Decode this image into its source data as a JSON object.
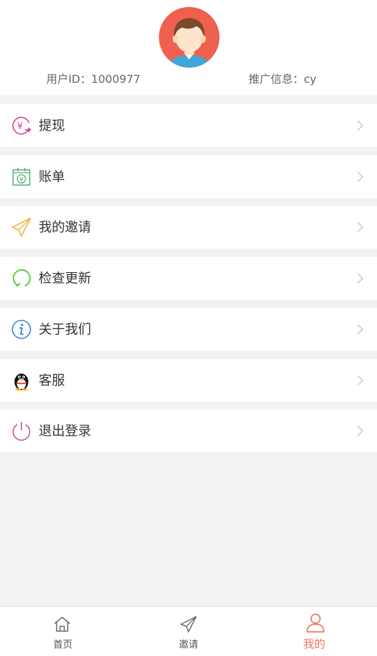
{
  "profile": {
    "user_id": "用户ID：1000977",
    "promo_info": "推广信息：cy"
  },
  "menu": {
    "items": [
      {
        "label": "提现",
        "icon": "yuan-withdraw-icon"
      },
      {
        "label": "账单",
        "icon": "bill-calendar-icon"
      },
      {
        "label": "我的邀请",
        "icon": "paper-plane-icon"
      },
      {
        "label": "检查更新",
        "icon": "refresh-icon"
      },
      {
        "label": "关于我们",
        "icon": "info-icon"
      },
      {
        "label": "客服",
        "icon": "qq-penguin-icon"
      },
      {
        "label": "退出登录",
        "icon": "power-icon"
      }
    ]
  },
  "tabbar": {
    "tabs": [
      {
        "label": "首页",
        "icon": "home-icon",
        "active": false
      },
      {
        "label": "邀请",
        "icon": "paper-plane-icon",
        "active": false
      },
      {
        "label": "我的",
        "icon": "user-icon",
        "active": true
      }
    ]
  },
  "colors": {
    "active_tab": "#f0765c",
    "withdraw_icon": "#d63a8a",
    "bill_icon": "#4fae6b",
    "invite_icon": "#f0b43c",
    "update_icon": "#4cc72a",
    "about_icon": "#3a7ed6",
    "logout_icon": "#b45aa0"
  }
}
